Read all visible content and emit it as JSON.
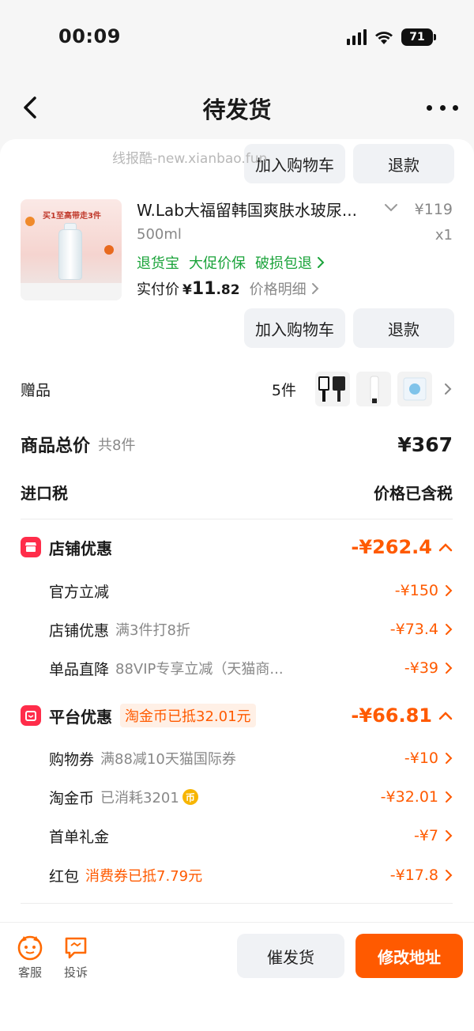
{
  "status_bar": {
    "time": "00:09",
    "battery": "71"
  },
  "nav": {
    "title": "待发货"
  },
  "watermark": "线报酷-new.xianbao.fun",
  "prev_item_actions": {
    "add_to_cart": "加入购物车",
    "refund": "退款"
  },
  "product": {
    "image_banner": "买1至高带走3件",
    "title": "W.Lab大福留韩国爽肤水玻尿...",
    "spec": "500ml",
    "price": "¥119",
    "quantity": "x1",
    "tags": [
      "退货宝",
      "大促价保",
      "破损包退"
    ],
    "paid_label": "实付价",
    "paid_currency": "¥",
    "paid_int": "11",
    "paid_dec": ".82",
    "price_detail": "价格明细",
    "add_to_cart": "加入购物车",
    "refund": "退款"
  },
  "gift": {
    "label": "赠品",
    "count": "5件"
  },
  "total": {
    "label": "商品总价",
    "sub": "共8件",
    "value": "¥367"
  },
  "tax": {
    "label": "进口税",
    "value": "价格已含税"
  },
  "shop_discount": {
    "title": "店铺优惠",
    "amount": "-¥262.4",
    "items": [
      {
        "label": "官方立减",
        "desc": "",
        "amount": "-¥150"
      },
      {
        "label": "店铺优惠",
        "desc": "满3件打8折",
        "amount": "-¥73.4"
      },
      {
        "label": "单品直降",
        "desc": "88VIP专享立减（天猫商...",
        "amount": "-¥39"
      }
    ]
  },
  "platform_discount": {
    "title": "平台优惠",
    "badge": "淘金币已抵32.01元",
    "amount": "-¥66.81",
    "items": [
      {
        "label": "购物券",
        "desc": "满88减10天猫国际券",
        "amount": "-¥10"
      },
      {
        "label": "淘金币",
        "desc": "已消耗3201",
        "amount": "-¥32.01",
        "coin": "币"
      },
      {
        "label": "首单礼金",
        "desc": "",
        "amount": "-¥7"
      },
      {
        "label": "红包",
        "desc": "消费券已抵7.79元",
        "amount": "-¥17.8"
      }
    ]
  },
  "bottom_bar": {
    "service": "客服",
    "complain": "投诉",
    "remind_ship": "催发货",
    "modify_address": "修改地址"
  },
  "colors": {
    "accent_orange": "#ff5a00",
    "tag_green": "#1aa33a",
    "shop_icon_red": "#ff2d4a"
  }
}
